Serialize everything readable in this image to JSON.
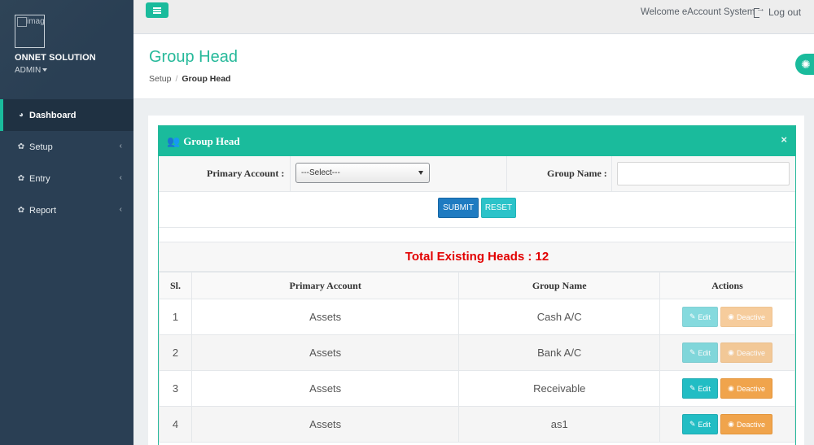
{
  "sidebar": {
    "avatar_alt": "imag",
    "org_name": "ONNET SOLUTION",
    "role": "ADMIN",
    "items": [
      {
        "label": "Dashboard",
        "icon": "dashboard-icon",
        "active": true
      },
      {
        "label": "Setup",
        "icon": "gear-icon",
        "active": false
      },
      {
        "label": "Entry",
        "icon": "gear-icon",
        "active": false
      },
      {
        "label": "Report",
        "icon": "gear-icon",
        "active": false
      }
    ]
  },
  "topbar": {
    "welcome": "Welcome eAccount System",
    "logout": "Log out"
  },
  "header": {
    "title": "Group Head",
    "breadcrumb": [
      "Setup",
      "Group Head"
    ]
  },
  "panel": {
    "title": "Group Head",
    "close": "×",
    "form": {
      "primary_account_label": "Primary Account :",
      "primary_account_value": "---Select---",
      "group_name_label": "Group Name :",
      "group_name_value": ""
    },
    "buttons": {
      "submit": "SUBMIT",
      "reset": "RESET"
    },
    "total_text": "Total Existing Heads : 12",
    "table": {
      "headers": [
        "Sl.",
        "Primary Account",
        "Group Name",
        "Actions"
      ],
      "rows": [
        {
          "sl": "1",
          "primary_account": "Assets",
          "group_name": "Cash A/C",
          "edit": "Edit",
          "deactive": "Deactive",
          "enabled": false
        },
        {
          "sl": "2",
          "primary_account": "Assets",
          "group_name": "Bank A/C",
          "edit": "Edit",
          "deactive": "Deactive",
          "enabled": false
        },
        {
          "sl": "3",
          "primary_account": "Assets",
          "group_name": "Receivable",
          "edit": "Edit",
          "deactive": "Deactive",
          "enabled": true
        },
        {
          "sl": "4",
          "primary_account": "Assets",
          "group_name": "as1",
          "edit": "Edit",
          "deactive": "Deactive",
          "enabled": true
        }
      ]
    }
  },
  "colors": {
    "accent": "#1abb9c",
    "sidebar_bg": "#2a3f54",
    "total_red": "#e20000",
    "submit_blue": "#1f7bc1",
    "edit_teal": "#22bdc4",
    "deactive_orange": "#f0a44c"
  }
}
